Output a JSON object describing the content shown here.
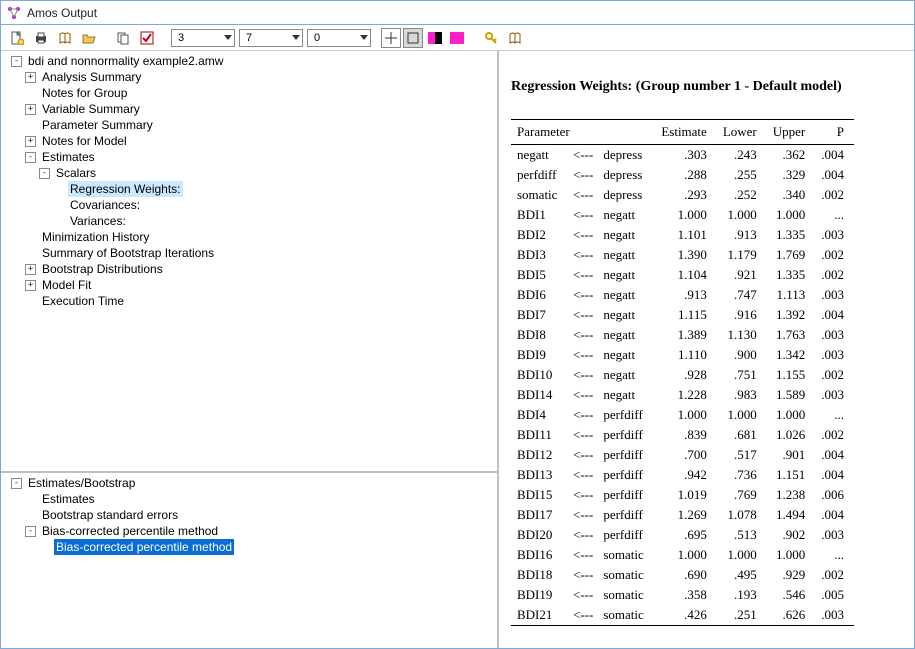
{
  "window": {
    "title": "Amos Output"
  },
  "toolbar": {
    "combo1": "3",
    "combo2": "7",
    "combo3": "0"
  },
  "tree_top": {
    "root": "bdi and nonnormality example2.amw",
    "analysis_summary": "Analysis Summary",
    "notes_for_group": "Notes for Group",
    "variable_summary": "Variable Summary",
    "parameter_summary": "Parameter Summary",
    "notes_for_model": "Notes for Model",
    "estimates": "Estimates",
    "scalars": "Scalars",
    "regression_weights": "Regression Weights:",
    "covariances": "Covariances:",
    "variances": "Variances:",
    "minimization_history": "Minimization History",
    "summary_bootstrap": "Summary of Bootstrap Iterations",
    "bootstrap_distributions": "Bootstrap Distributions",
    "model_fit": "Model Fit",
    "execution_time": "Execution Time"
  },
  "tree_bottom": {
    "root": "Estimates/Bootstrap",
    "estimates": "Estimates",
    "bse": "Bootstrap standard errors",
    "bcpm": "Bias-corrected percentile method",
    "bcpm_child": "Bias-corrected percentile method"
  },
  "table": {
    "heading": "Regression Weights: (Group number 1 - Default model)",
    "headers": {
      "param": "Parameter",
      "est": "Estimate",
      "low": "Lower",
      "up": "Upper",
      "p": "P"
    },
    "rows": [
      {
        "to": "negatt",
        "from": "depress",
        "est": ".303",
        "low": ".243",
        "up": ".362",
        "p": ".004"
      },
      {
        "to": "perfdiff",
        "from": "depress",
        "est": ".288",
        "low": ".255",
        "up": ".329",
        "p": ".004"
      },
      {
        "to": "somatic",
        "from": "depress",
        "est": ".293",
        "low": ".252",
        "up": ".340",
        "p": ".002"
      },
      {
        "to": "BDI1",
        "from": "negatt",
        "est": "1.000",
        "low": "1.000",
        "up": "1.000",
        "p": "..."
      },
      {
        "to": "BDI2",
        "from": "negatt",
        "est": "1.101",
        "low": ".913",
        "up": "1.335",
        "p": ".003"
      },
      {
        "to": "BDI3",
        "from": "negatt",
        "est": "1.390",
        "low": "1.179",
        "up": "1.769",
        "p": ".002"
      },
      {
        "to": "BDI5",
        "from": "negatt",
        "est": "1.104",
        "low": ".921",
        "up": "1.335",
        "p": ".002"
      },
      {
        "to": "BDI6",
        "from": "negatt",
        "est": ".913",
        "low": ".747",
        "up": "1.113",
        "p": ".003"
      },
      {
        "to": "BDI7",
        "from": "negatt",
        "est": "1.115",
        "low": ".916",
        "up": "1.392",
        "p": ".004"
      },
      {
        "to": "BDI8",
        "from": "negatt",
        "est": "1.389",
        "low": "1.130",
        "up": "1.763",
        "p": ".003"
      },
      {
        "to": "BDI9",
        "from": "negatt",
        "est": "1.110",
        "low": ".900",
        "up": "1.342",
        "p": ".003"
      },
      {
        "to": "BDI10",
        "from": "negatt",
        "est": ".928",
        "low": ".751",
        "up": "1.155",
        "p": ".002"
      },
      {
        "to": "BDI14",
        "from": "negatt",
        "est": "1.228",
        "low": ".983",
        "up": "1.589",
        "p": ".003"
      },
      {
        "to": "BDI4",
        "from": "perfdiff",
        "est": "1.000",
        "low": "1.000",
        "up": "1.000",
        "p": "..."
      },
      {
        "to": "BDI11",
        "from": "perfdiff",
        "est": ".839",
        "low": ".681",
        "up": "1.026",
        "p": ".002"
      },
      {
        "to": "BDI12",
        "from": "perfdiff",
        "est": ".700",
        "low": ".517",
        "up": ".901",
        "p": ".004"
      },
      {
        "to": "BDI13",
        "from": "perfdiff",
        "est": ".942",
        "low": ".736",
        "up": "1.151",
        "p": ".004"
      },
      {
        "to": "BDI15",
        "from": "perfdiff",
        "est": "1.019",
        "low": ".769",
        "up": "1.238",
        "p": ".006"
      },
      {
        "to": "BDI17",
        "from": "perfdiff",
        "est": "1.269",
        "low": "1.078",
        "up": "1.494",
        "p": ".004"
      },
      {
        "to": "BDI20",
        "from": "perfdiff",
        "est": ".695",
        "low": ".513",
        "up": ".902",
        "p": ".003"
      },
      {
        "to": "BDI16",
        "from": "somatic",
        "est": "1.000",
        "low": "1.000",
        "up": "1.000",
        "p": "..."
      },
      {
        "to": "BDI18",
        "from": "somatic",
        "est": ".690",
        "low": ".495",
        "up": ".929",
        "p": ".002"
      },
      {
        "to": "BDI19",
        "from": "somatic",
        "est": ".358",
        "low": ".193",
        "up": ".546",
        "p": ".005"
      },
      {
        "to": "BDI21",
        "from": "somatic",
        "est": ".426",
        "low": ".251",
        "up": ".626",
        "p": ".003"
      }
    ],
    "arrow": "<---"
  }
}
